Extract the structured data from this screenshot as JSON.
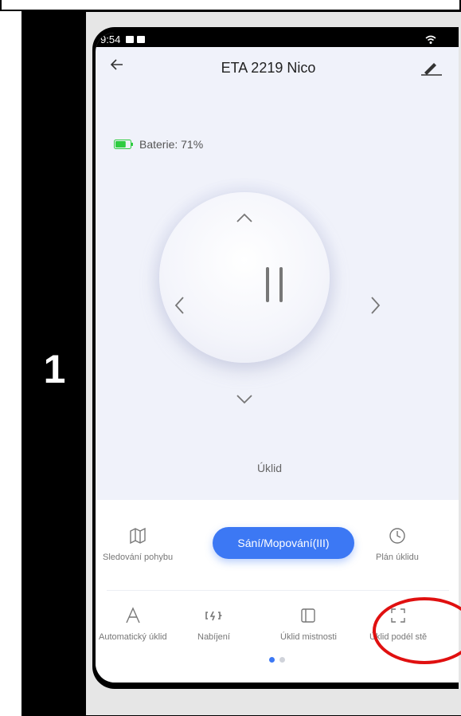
{
  "step": {
    "number": "1"
  },
  "status_bar": {
    "time": "9:54"
  },
  "header": {
    "title": "ETA 2219 Nico"
  },
  "battery": {
    "label": "Baterie: 71%",
    "level": 0.71
  },
  "main": {
    "mode_label": "Úklid"
  },
  "bottom": {
    "mode_button": "Sání/Mopování(III)",
    "row1": [
      {
        "label": "Sledování pohybu",
        "icon": "map-icon"
      },
      {
        "label": "Plán úklidu",
        "icon": "clock-icon"
      }
    ],
    "row2": [
      {
        "label": "Automatický úklid",
        "icon": "letter-a-icon"
      },
      {
        "label": "Nabíjení",
        "icon": "charging-icon"
      },
      {
        "label": "Úklid mistnosti",
        "icon": "room-icon"
      },
      {
        "label": "Úklid podél stě",
        "icon": "edge-icon"
      }
    ],
    "pagination": {
      "current": 1,
      "total": 2
    }
  },
  "colors": {
    "accent": "#3c78f4",
    "highlight": "#e01010",
    "battery": "#2ecc40"
  }
}
